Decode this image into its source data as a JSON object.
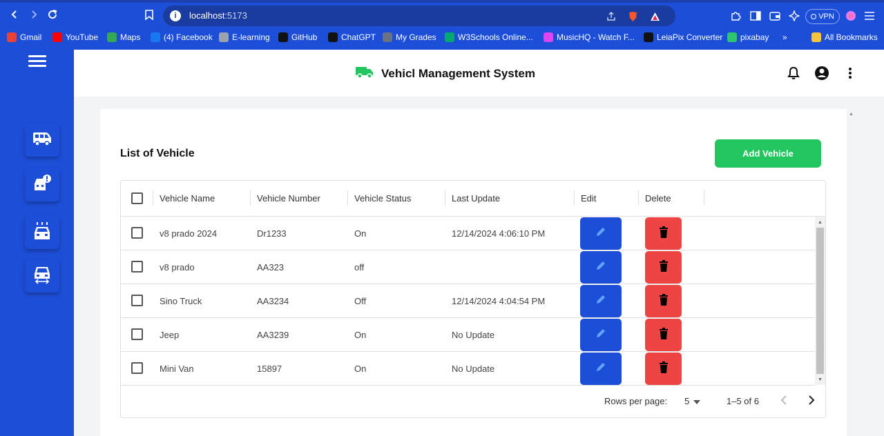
{
  "browser": {
    "url_host": "localhost",
    "url_port": ":5173",
    "vpn_label": "VPN",
    "bookmarks": [
      {
        "label": "Gmail",
        "icon": "gmail-icon",
        "color": "#ea4335"
      },
      {
        "label": "YouTube",
        "icon": "youtube-icon",
        "color": "#ff0000"
      },
      {
        "label": "Maps",
        "icon": "maps-icon",
        "color": "#34a853"
      },
      {
        "label": "(4) Facebook",
        "icon": "facebook-icon",
        "color": "#1877f2"
      },
      {
        "label": "E-learning",
        "icon": "elearning-icon",
        "color": "#9ca3af"
      },
      {
        "label": "GitHub",
        "icon": "github-icon",
        "color": "#111111"
      },
      {
        "label": "ChatGPT",
        "icon": "chatgpt-icon",
        "color": "#111111"
      },
      {
        "label": "My Grades",
        "icon": "grades-icon",
        "color": "#6b7280"
      },
      {
        "label": "W3Schools Online...",
        "icon": "w3schools-icon",
        "color": "#04aa6d"
      },
      {
        "label": "MusicHQ - Watch F...",
        "icon": "musichq-icon",
        "color": "#d946ef"
      },
      {
        "label": "LeiaPix Converter",
        "icon": "leiapix-icon",
        "color": "#111111"
      },
      {
        "label": "pixabay",
        "icon": "pixabay-icon",
        "color": "#2ec66d"
      },
      {
        "label": "»",
        "icon": "more-bookmarks-icon",
        "color": "#ffffff"
      },
      {
        "label": "All Bookmarks",
        "icon": "folder-icon",
        "color": "#f5c542"
      }
    ]
  },
  "app": {
    "title": "Vehicl Management System",
    "brand_color": "#22c55e",
    "sidebar_color": "#1d4ed8",
    "sidebar_items": [
      "van-icon",
      "car-alert-icon",
      "car-wash-icon",
      "car-transfer-icon"
    ]
  },
  "page": {
    "heading": "List of Vehicle",
    "add_button": "Add Vehicle"
  },
  "table": {
    "columns": [
      "Vehicle Name",
      "Vehicle Number",
      "Vehicle Status",
      "Last Update",
      "Edit",
      "Delete"
    ],
    "rows": [
      {
        "name": "v8 prado 2024",
        "number": "Dr1233",
        "status": "On",
        "updated": "12/14/2024 4:06:10 PM"
      },
      {
        "name": "v8 prado",
        "number": "AA323",
        "status": "off",
        "updated": ""
      },
      {
        "name": "Sino Truck",
        "number": "AA3234",
        "status": "Off",
        "updated": "12/14/2024 4:04:54 PM"
      },
      {
        "name": "Jeep",
        "number": "AA3239",
        "status": "On",
        "updated": "No Update"
      },
      {
        "name": "Mini Van",
        "number": "15897",
        "status": "On",
        "updated": "No Update"
      }
    ],
    "edit_color": "#1d4ed8",
    "delete_color": "#ef4444"
  },
  "pagination": {
    "rows_per_page_label": "Rows per page:",
    "rows_per_page_value": "5",
    "range_label": "1–5 of 6"
  }
}
